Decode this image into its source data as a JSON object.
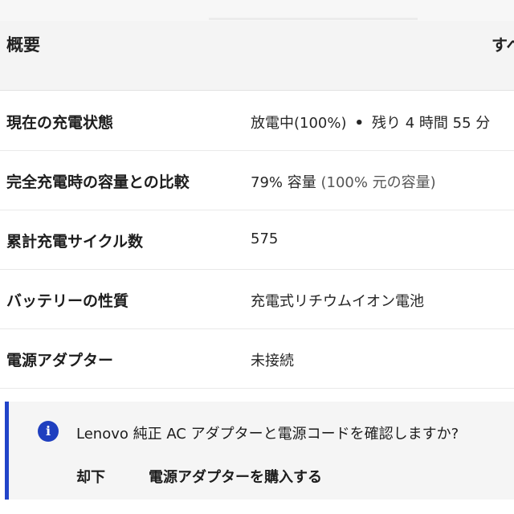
{
  "header": {
    "title": "概要",
    "see_all": "すべ"
  },
  "rows": [
    {
      "label": "現在の充電状態",
      "value_main": "放電中(100%)",
      "value_sep": "•",
      "value_extra": "残り 4 時間 55 分"
    },
    {
      "label": "完全充電時の容量との比較",
      "value_main": "79% 容量",
      "value_extra": "(100% 元の容量)"
    },
    {
      "label": "累計充電サイクル数",
      "value_main": "575"
    },
    {
      "label": "バッテリーの性質",
      "value_main": "充電式リチウムイオン電池"
    },
    {
      "label": "電源アダプター",
      "value_main": "未接続"
    }
  ],
  "banner": {
    "icon": "info-icon",
    "icon_glyph": "i",
    "message": "Lenovo 純正 AC アダプターと電源コードを確認しますか?",
    "dismiss_label": "却下",
    "buy_label": "電源アダプターを購入する"
  },
  "colors": {
    "accent": "#2144c9",
    "info_icon_bg": "#1f3fbf"
  }
}
